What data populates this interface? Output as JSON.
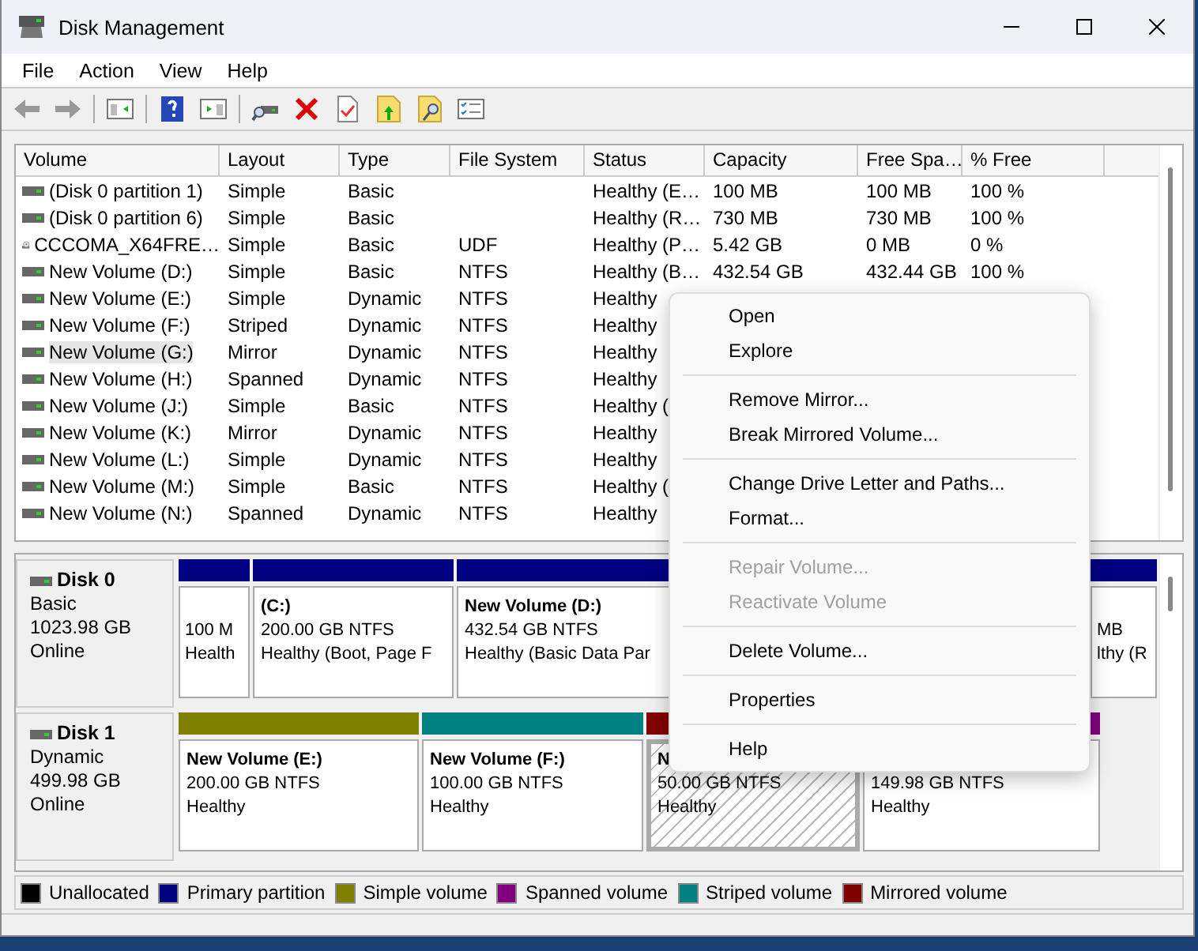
{
  "window": {
    "title": "Disk Management"
  },
  "menu_bar": [
    "File",
    "Action",
    "View",
    "Help"
  ],
  "volume_table": {
    "columns": [
      "Volume",
      "Layout",
      "Type",
      "File System",
      "Status",
      "Capacity",
      "Free Spa…",
      "% Free"
    ],
    "rows": [
      {
        "kind": "drive",
        "selected": false,
        "cells": [
          "(Disk 0 partition 1)",
          "Simple",
          "Basic",
          "",
          "Healthy (E…",
          "100 MB",
          "100 MB",
          "100 %"
        ]
      },
      {
        "kind": "drive",
        "selected": false,
        "cells": [
          "(Disk 0 partition 6)",
          "Simple",
          "Basic",
          "",
          "Healthy (R…",
          "730 MB",
          "730 MB",
          "100 %"
        ]
      },
      {
        "kind": "optical",
        "selected": false,
        "cells": [
          "CCCOMA_X64FRE…",
          "Simple",
          "Basic",
          "UDF",
          "Healthy (P…",
          "5.42 GB",
          "0 MB",
          "0 %"
        ]
      },
      {
        "kind": "drive",
        "selected": false,
        "cells": [
          "New Volume (D:)",
          "Simple",
          "Basic",
          "NTFS",
          "Healthy (B…",
          "432.54 GB",
          "432.44 GB",
          "100 %"
        ]
      },
      {
        "kind": "drive",
        "selected": false,
        "cells": [
          "New Volume (E:)",
          "Simple",
          "Dynamic",
          "NTFS",
          "Healthy"
        ]
      },
      {
        "kind": "drive",
        "selected": false,
        "cells": [
          "New Volume (F:)",
          "Striped",
          "Dynamic",
          "NTFS",
          "Healthy"
        ]
      },
      {
        "kind": "drive",
        "selected": true,
        "cells": [
          "New Volume (G:)",
          "Mirror",
          "Dynamic",
          "NTFS",
          "Healthy"
        ]
      },
      {
        "kind": "drive",
        "selected": false,
        "cells": [
          "New Volume (H:)",
          "Spanned",
          "Dynamic",
          "NTFS",
          "Healthy"
        ]
      },
      {
        "kind": "drive",
        "selected": false,
        "cells": [
          "New Volume (J:)",
          "Simple",
          "Basic",
          "NTFS",
          "Healthy ("
        ]
      },
      {
        "kind": "drive",
        "selected": false,
        "cells": [
          "New Volume (K:)",
          "Mirror",
          "Dynamic",
          "NTFS",
          "Healthy"
        ]
      },
      {
        "kind": "drive",
        "selected": false,
        "cells": [
          "New Volume (L:)",
          "Simple",
          "Dynamic",
          "NTFS",
          "Healthy"
        ]
      },
      {
        "kind": "drive",
        "selected": false,
        "cells": [
          "New Volume (M:)",
          "Simple",
          "Basic",
          "NTFS",
          "Healthy ("
        ]
      },
      {
        "kind": "drive",
        "selected": false,
        "cells": [
          "New Volume (N:)",
          "Spanned",
          "Dynamic",
          "NTFS",
          "Healthy"
        ]
      }
    ]
  },
  "disks": [
    {
      "name": "Disk 0",
      "type": "Basic",
      "size": "1023.98 GB",
      "status": "Online",
      "partitions": [
        {
          "color": "#000080",
          "selected": false,
          "lines": [
            "100 M",
            "Health"
          ]
        },
        {
          "color": "#000080",
          "selected": false,
          "title": "(C:)",
          "lines": [
            "200.00 GB NTFS",
            "Healthy (Boot, Page F"
          ]
        },
        {
          "color": "#000080",
          "selected": false,
          "title": "New Volume  (D:)",
          "lines": [
            "432.54 GB NTFS",
            "Healthy (Basic Data Par"
          ]
        },
        {
          "color": "#000080",
          "selected": false,
          "lines": [
            "MB",
            "lthy (R"
          ]
        }
      ]
    },
    {
      "name": "Disk 1",
      "type": "Dynamic",
      "size": "499.98 GB",
      "status": "Online",
      "partitions": [
        {
          "color": "#808000",
          "selected": false,
          "title": "New Volume  (E:)",
          "lines": [
            "200.00 GB NTFS",
            "Healthy"
          ]
        },
        {
          "color": "#008080",
          "selected": false,
          "title": "New Volume  (F:)",
          "lines": [
            "100.00 GB NTFS",
            "Healthy"
          ]
        },
        {
          "color": "#800000",
          "selected": true,
          "title": "N",
          "lines": [
            "50.00 GB NTFS",
            "Healthy"
          ]
        },
        {
          "color": "#800080",
          "selected": false,
          "lines": [
            "149.98 GB NTFS",
            "Healthy"
          ]
        }
      ]
    }
  ],
  "legend": [
    {
      "label": "Unallocated",
      "color": "#000000"
    },
    {
      "label": "Primary partition",
      "color": "#000080"
    },
    {
      "label": "Simple volume",
      "color": "#808000"
    },
    {
      "label": "Spanned volume",
      "color": "#800080"
    },
    {
      "label": "Striped volume",
      "color": "#008080"
    },
    {
      "label": "Mirrored volume",
      "color": "#800000"
    }
  ],
  "context_menu": [
    {
      "kind": "item",
      "label": "Open",
      "disabled": false
    },
    {
      "kind": "item",
      "label": "Explore",
      "disabled": false
    },
    {
      "kind": "separator"
    },
    {
      "kind": "item",
      "label": "Remove Mirror...",
      "disabled": false
    },
    {
      "kind": "item",
      "label": "Break Mirrored Volume...",
      "disabled": false
    },
    {
      "kind": "separator"
    },
    {
      "kind": "item",
      "label": "Change Drive Letter and Paths...",
      "disabled": false
    },
    {
      "kind": "item",
      "label": "Format...",
      "disabled": false
    },
    {
      "kind": "separator"
    },
    {
      "kind": "item",
      "label": "Repair Volume...",
      "disabled": true
    },
    {
      "kind": "item",
      "label": "Reactivate Volume",
      "disabled": true
    },
    {
      "kind": "separator"
    },
    {
      "kind": "item",
      "label": "Delete Volume...",
      "disabled": false
    },
    {
      "kind": "separator"
    },
    {
      "kind": "item",
      "label": "Properties",
      "disabled": false
    },
    {
      "kind": "separator"
    },
    {
      "kind": "item",
      "label": "Help",
      "disabled": false
    }
  ]
}
